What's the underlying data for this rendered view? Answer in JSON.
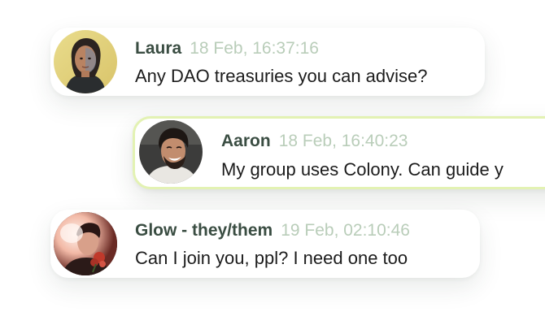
{
  "messages": [
    {
      "author": "Laura",
      "timestamp": "18 Feb, 16:37:16",
      "text": "Any DAO treasuries you can advise?",
      "avatar_icon": "avatar-woman-portrait",
      "highlighted": false
    },
    {
      "author": "Aaron",
      "timestamp": "18 Feb, 16:40:23",
      "text": "My group uses Colony. Can guide y",
      "avatar_icon": "avatar-man-laughing",
      "highlighted": true
    },
    {
      "author": "Glow - they/them",
      "timestamp": "19 Feb, 02:10:46",
      "text": "Can I join you, ppl? I need one too",
      "avatar_icon": "avatar-person-flowers",
      "highlighted": false
    }
  ],
  "colors": {
    "author_name": "#3a4d42",
    "timestamp": "#b9cdb9",
    "message_text": "#1c1c1c",
    "highlight_border": "#e3f2b3"
  }
}
